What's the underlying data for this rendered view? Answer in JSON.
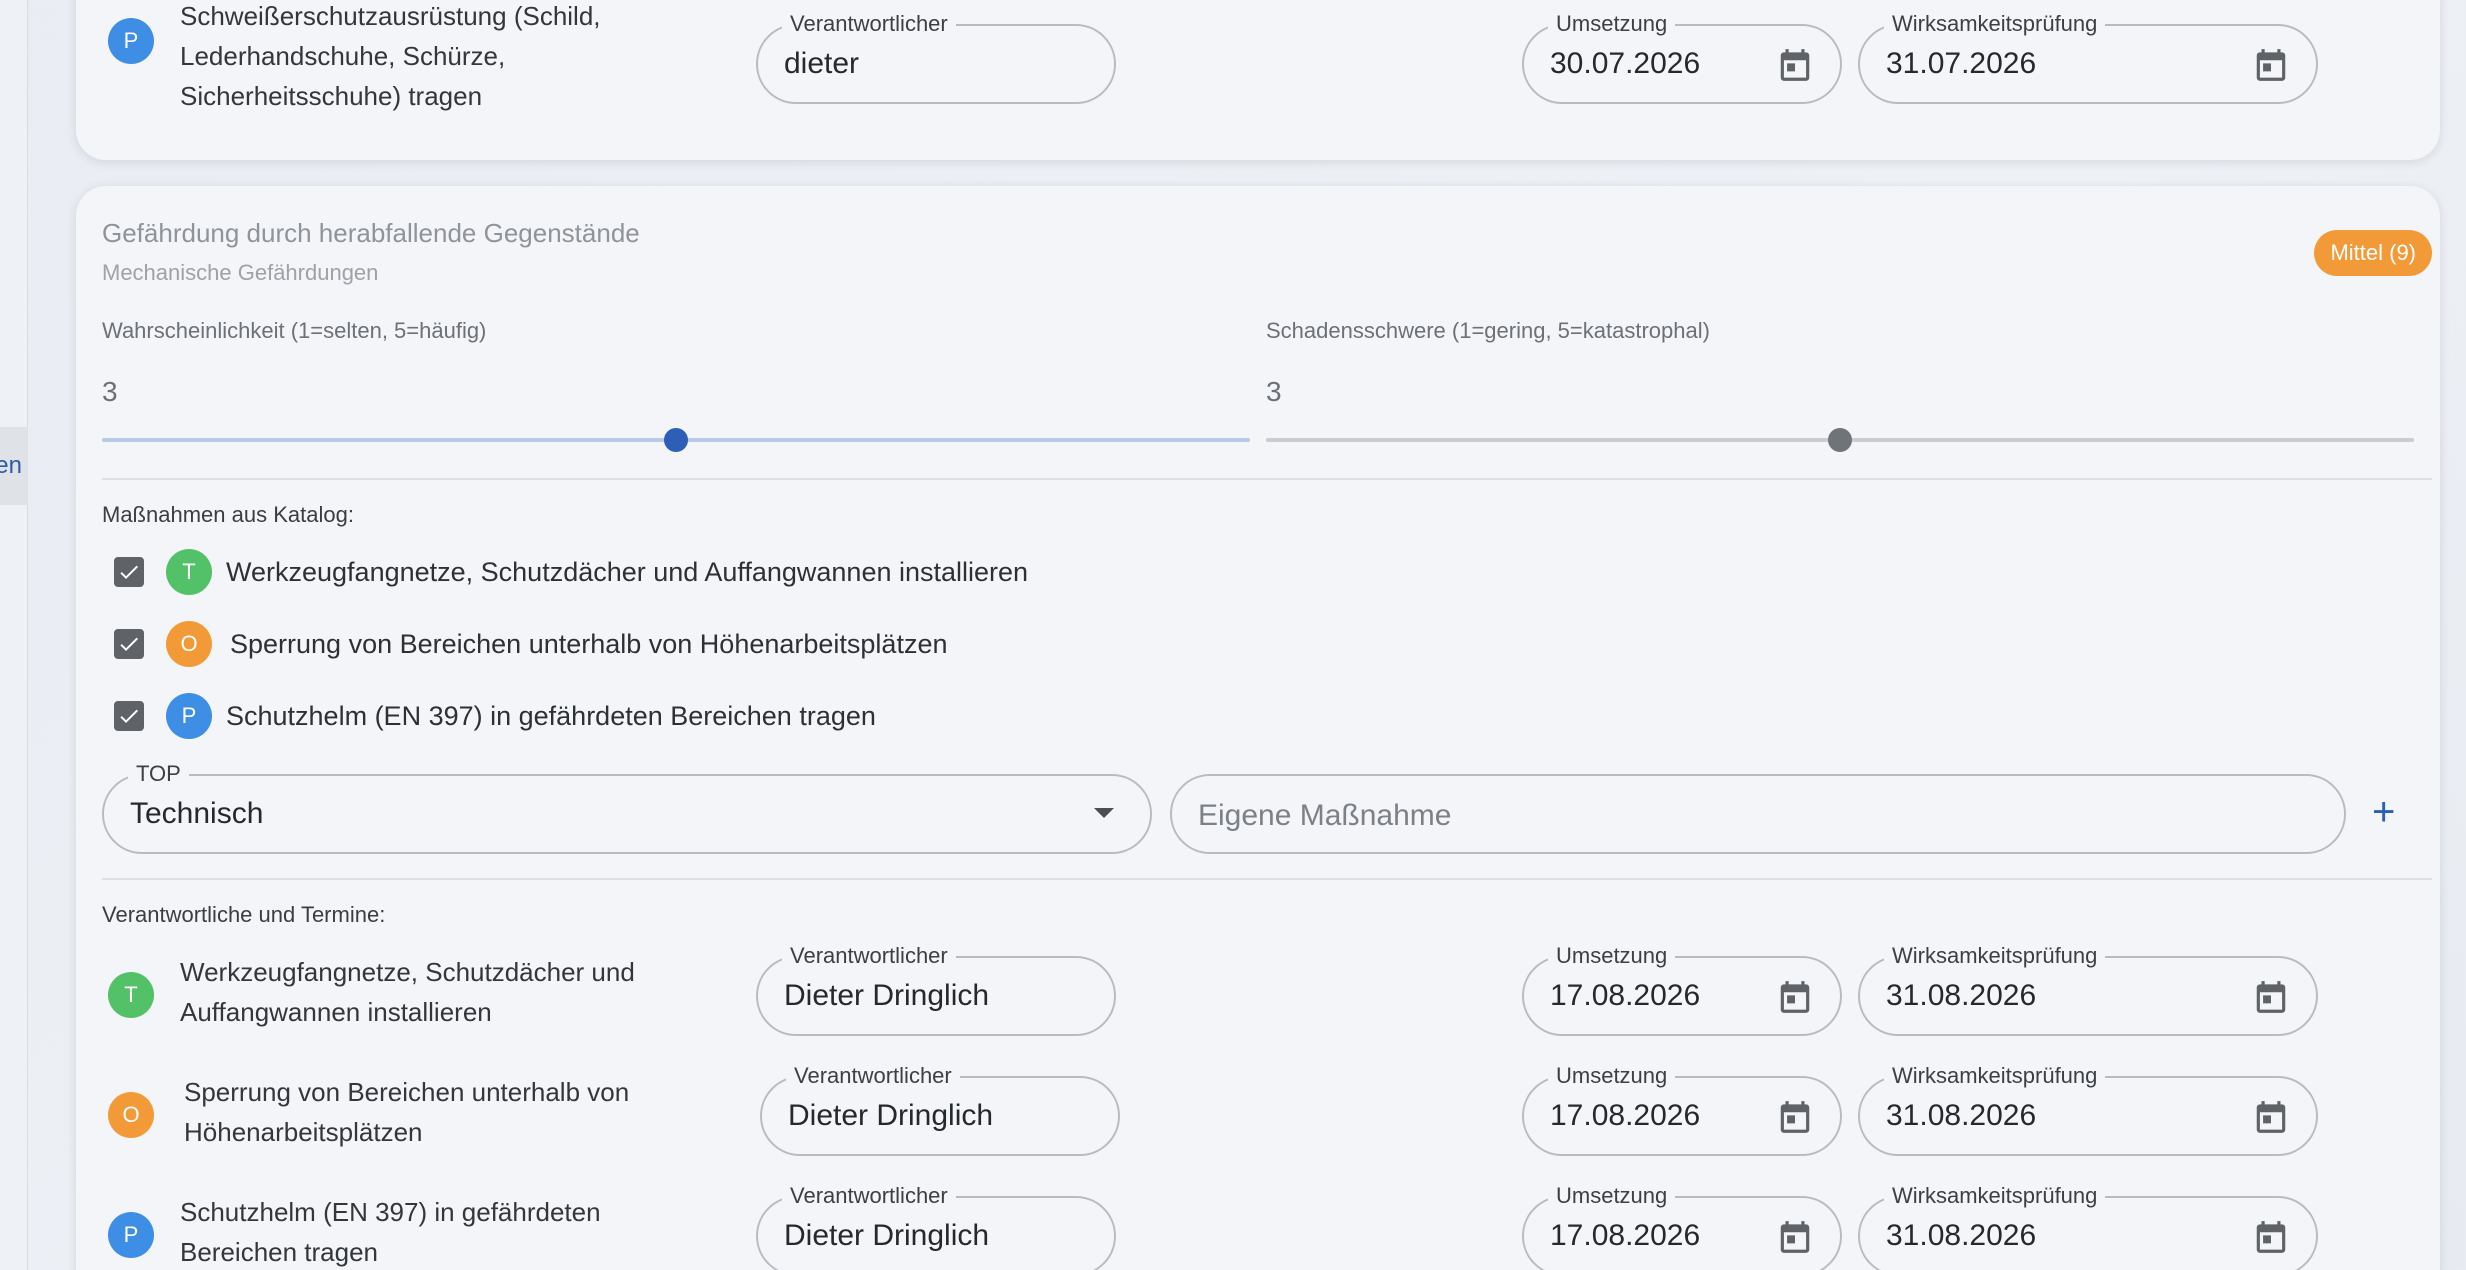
{
  "nav": {
    "tab_label": "en"
  },
  "top_row": {
    "avatar": "P",
    "text": "Schweißerschutzausrüstung (Schild,\nLederhandschuhe, Schürze,\nSicherheitsschuhe) tragen",
    "responsible_label": "Verantwortlicher",
    "responsible_value": "dieter",
    "impl_label": "Umsetzung",
    "impl_value": "30.07.2026",
    "check_label": "Wirksamkeitsprüfung",
    "check_value": "31.07.2026"
  },
  "hazard": {
    "title": "Gefährdung durch herabfallende Gegenstände",
    "category": "Mechanische Gefährdungen",
    "badge": "Mittel (9)",
    "badge_color": "#f29a37",
    "probability_label": "Wahrscheinlichkeit (1=selten, 5=häufig)",
    "probability_value": "3",
    "probability_level": 3,
    "severity_label": "Schadensschwere (1=gering, 5=katastrophal)",
    "severity_value": "3",
    "severity_level": 3
  },
  "catalog": {
    "label": "Maßnahmen aus Katalog:",
    "items": [
      {
        "avatar": "T",
        "text": "Werkzeugfangnetze, Schutzdächer und Auffangwannen installieren",
        "checked": true
      },
      {
        "avatar": "O",
        "text": "Sperrung von Bereichen unterhalb von Höhenarbeitsplätzen",
        "checked": true
      },
      {
        "avatar": "P",
        "text": "Schutzhelm (EN 397) in gefährdeten Bereichen tragen",
        "checked": true
      }
    ]
  },
  "add_measure": {
    "top_label": "TOP",
    "top_value": "Technisch",
    "own_placeholder": "Eigene Maßnahme",
    "add_symbol": "+"
  },
  "responsibles": {
    "label": "Verantwortliche und Termine:",
    "field_labels": {
      "responsible": "Verantwortlicher",
      "impl": "Umsetzung",
      "check": "Wirksamkeitsprüfung"
    },
    "rows": [
      {
        "avatar": "T",
        "text": "Werkzeugfangnetze, Schutzdächer und\nAuffangwannen installieren",
        "responsible": "Dieter Dringlich",
        "impl": "17.08.2026",
        "check": "31.08.2026"
      },
      {
        "avatar": "O",
        "text": "Sperrung von Bereichen unterhalb von\nHöhenarbeitsplätzen",
        "responsible": "Dieter Dringlich",
        "impl": "17.08.2026",
        "check": "31.08.2026"
      },
      {
        "avatar": "P",
        "text": "Schutzhelm (EN 397) in gefährdeten\nBereichen tragen",
        "responsible": "Dieter Dringlich",
        "impl": "17.08.2026",
        "check": "31.08.2026"
      }
    ]
  }
}
